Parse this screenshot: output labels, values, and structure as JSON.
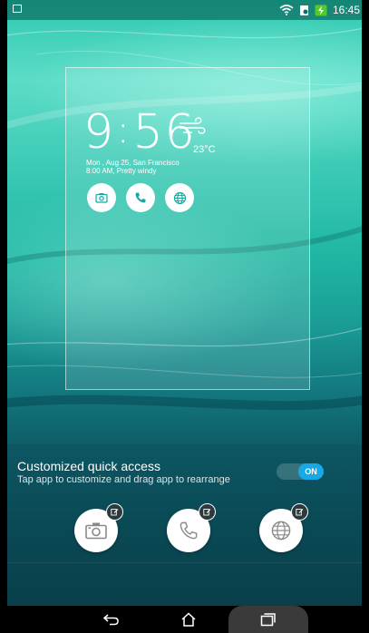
{
  "status_bar": {
    "time": "16:45",
    "icons": [
      "notification-icon",
      "wifi-icon",
      "battery-saver-icon",
      "battery-charging-icon"
    ]
  },
  "widget": {
    "clock_hour": "9",
    "clock_colon": ":",
    "clock_minutes": "56",
    "temperature": "23°C",
    "date_line": "Mon , Aug 25, San Francisco",
    "weather_line": "8:00 AM, Pretty windy",
    "apps": [
      "camera-icon",
      "phone-icon",
      "browser-icon"
    ]
  },
  "quick_access": {
    "title": "Customized quick access",
    "subtitle": "Tap app to customize and drag app to rearrange",
    "toggle_label": "ON",
    "toggle_state": "on",
    "apps": [
      "camera-icon",
      "phone-icon",
      "browser-icon"
    ]
  },
  "navigation": {
    "buttons": [
      "back-icon",
      "home-icon",
      "recent-apps-icon"
    ]
  },
  "colors": {
    "accent": "#17a9e6",
    "panel": "#0a4c57",
    "wallpaper_mid": "#3bcab5"
  }
}
